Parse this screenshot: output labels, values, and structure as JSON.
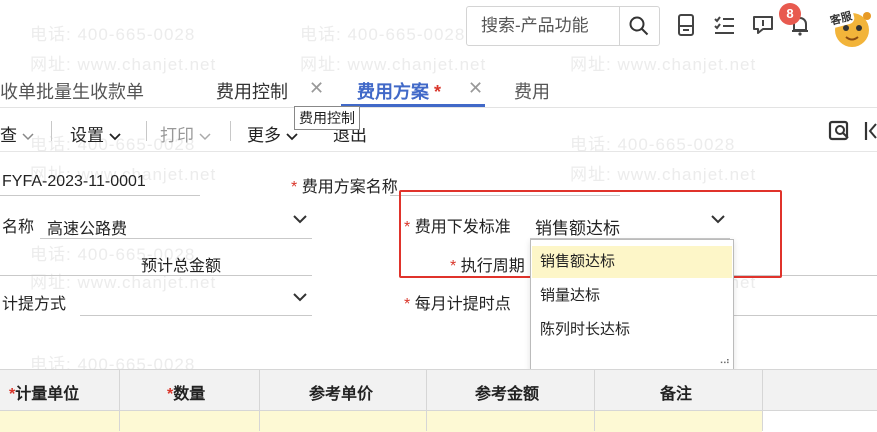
{
  "watermark": {
    "phone": "电话: 400-665-0028",
    "site": "网址: www.chanjet.net"
  },
  "topbar": {
    "search_placeholder": "搜索-产品功能",
    "notification_count": "8",
    "service_label": "客服"
  },
  "tabs": [
    {
      "label": "收单批量生收款单"
    },
    {
      "label": "费用控制",
      "close": "✕"
    },
    {
      "label": "费用方案",
      "modified_mark": "*",
      "close": "✕",
      "active": true
    },
    {
      "label": "费用"
    }
  ],
  "tooltip": "费用控制",
  "toolbar": {
    "query": "查",
    "settings": "设置",
    "print": "打印",
    "more": "更多",
    "exit": "退出"
  },
  "form": {
    "code_value": "FYFA-2023-11-0001",
    "scheme_name_label": "费用方案名称",
    "name_label": "名称",
    "name_value": "高速公路费",
    "issue_standard_label": "费用下发标准",
    "issue_standard_value": "销售额达标",
    "estimated_total_label": "预计总金额",
    "exec_period_label": "执行周期",
    "accrual_method_label": "计提方式",
    "monthly_accrual_label": "每月计提时点",
    "required_mark": "*"
  },
  "dropdown": {
    "options": [
      "销售额达标",
      "销量达标",
      "陈列时长达标"
    ],
    "selected_index": 0
  },
  "grid": {
    "headers": [
      {
        "label": "计量单位",
        "required": true
      },
      {
        "label": "数量",
        "required": true
      },
      {
        "label": "参考单价",
        "required": false
      },
      {
        "label": "参考金额",
        "required": false
      },
      {
        "label": "备注",
        "required": false
      }
    ]
  },
  "colors": {
    "accent": "#4169c8",
    "required": "#d9362b",
    "highlight_box": "#e0332b",
    "selected_option": "#fdf6c8"
  }
}
